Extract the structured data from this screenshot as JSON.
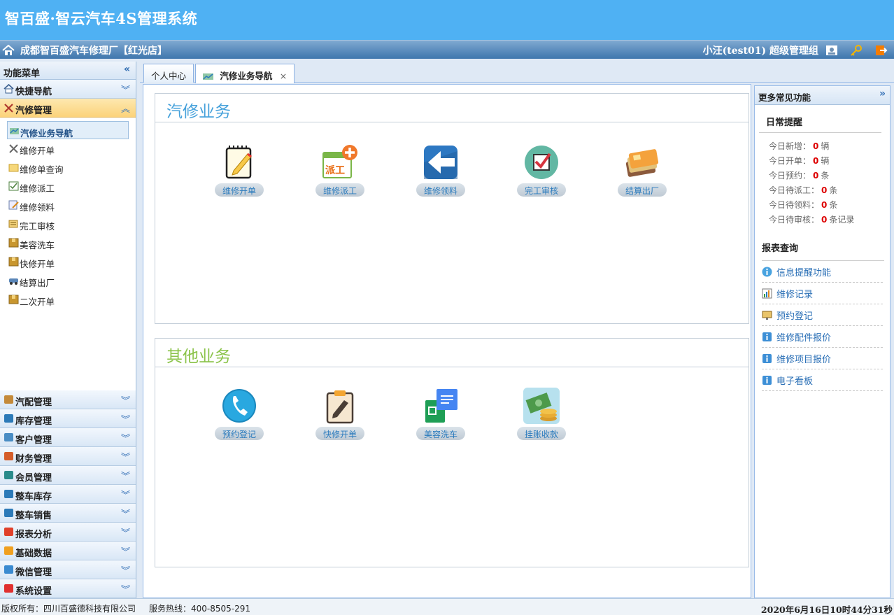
{
  "app": {
    "title": "智百盛·智云汽车4S管理系统"
  },
  "topbar": {
    "store": "成都智百盛汽车修理厂【红光店】",
    "user": "小汪(test01) 超级管理组"
  },
  "sidebar": {
    "header": "功能菜单",
    "groups_top": [
      {
        "label": "快捷导航",
        "icon": "home-icon"
      },
      {
        "label": "汽修管理",
        "icon": "tools-icon"
      }
    ],
    "items": [
      {
        "label": "汽修业务导航",
        "icon": "chart-icon"
      },
      {
        "label": "维修开单",
        "icon": "wrench-icon"
      },
      {
        "label": "维修单查询",
        "icon": "folder-icon"
      },
      {
        "label": "维修派工",
        "icon": "clipboard-icon"
      },
      {
        "label": "维修领料",
        "icon": "edit-icon"
      },
      {
        "label": "完工审核",
        "icon": "list-icon"
      },
      {
        "label": "美容洗车",
        "icon": "box-icon"
      },
      {
        "label": "快修开单",
        "icon": "box-icon"
      },
      {
        "label": "结算出厂",
        "icon": "car-icon"
      },
      {
        "label": "二次开单",
        "icon": "box-icon"
      }
    ],
    "groups_bottom": [
      {
        "label": "汽配管理",
        "icon": "parts-icon"
      },
      {
        "label": "库存管理",
        "icon": "warehouse-icon"
      },
      {
        "label": "客户管理",
        "icon": "customer-icon"
      },
      {
        "label": "财务管理",
        "icon": "finance-icon"
      },
      {
        "label": "会员管理",
        "icon": "member-icon"
      },
      {
        "label": "整车库存",
        "icon": "vehicle-stock-icon"
      },
      {
        "label": "整车销售",
        "icon": "vehicle-sales-icon"
      },
      {
        "label": "报表分析",
        "icon": "pie-chart-icon"
      },
      {
        "label": "基础数据",
        "icon": "database-icon"
      },
      {
        "label": "微信管理",
        "icon": "wechat-icon"
      },
      {
        "label": "系统设置",
        "icon": "settings-icon"
      }
    ]
  },
  "tabs": [
    {
      "label": "个人中心"
    },
    {
      "label": "汽修业务导航"
    }
  ],
  "section1": {
    "title": "汽修业务",
    "items": [
      {
        "label": "维修开单",
        "icon": "notepad-icon"
      },
      {
        "label": "维修派工",
        "icon": "dispatch-icon"
      },
      {
        "label": "维修领料",
        "icon": "arrow-back-icon"
      },
      {
        "label": "完工审核",
        "icon": "checkbox-icon"
      },
      {
        "label": "结算出厂",
        "icon": "cards-icon"
      }
    ]
  },
  "section2": {
    "title": "其他业务",
    "items": [
      {
        "label": "预约登记",
        "icon": "phone-icon"
      },
      {
        "label": "快修开单",
        "icon": "clipboard-pen-icon"
      },
      {
        "label": "美容洗车",
        "icon": "docs-icon"
      },
      {
        "label": "挂账收款",
        "icon": "money-icon"
      }
    ]
  },
  "right": {
    "header": "更多常见功能",
    "daily_title": "日常提醒",
    "stats": [
      {
        "label": "今日新增：",
        "value": "0",
        "unit": "辆"
      },
      {
        "label": "今日开单：",
        "value": "0",
        "unit": "辆"
      },
      {
        "label": "今日预约：",
        "value": "0",
        "unit": "条"
      },
      {
        "label": "今日待派工：",
        "value": "0",
        "unit": "条"
      },
      {
        "label": "今日待领料：",
        "value": "0",
        "unit": "条"
      },
      {
        "label": "今日待审核：",
        "value": "0",
        "unit": "条记录"
      }
    ],
    "report_title": "报表查询",
    "links": [
      {
        "label": "信息提醒功能",
        "icon": "info-icon"
      },
      {
        "label": "维修记录",
        "icon": "bar-chart-icon"
      },
      {
        "label": "预约登记",
        "icon": "screen-icon"
      },
      {
        "label": "维修配件报价",
        "icon": "info-square-icon"
      },
      {
        "label": "维修项目报价",
        "icon": "info-square-icon"
      },
      {
        "label": "电子看板",
        "icon": "info-square-icon"
      }
    ]
  },
  "footer": {
    "copyright": "版权所有：四川百盛德科技有限公司",
    "hotline": "服务热线：400-8505-291",
    "datetime": "2020年6月16日10时44分31秒"
  }
}
